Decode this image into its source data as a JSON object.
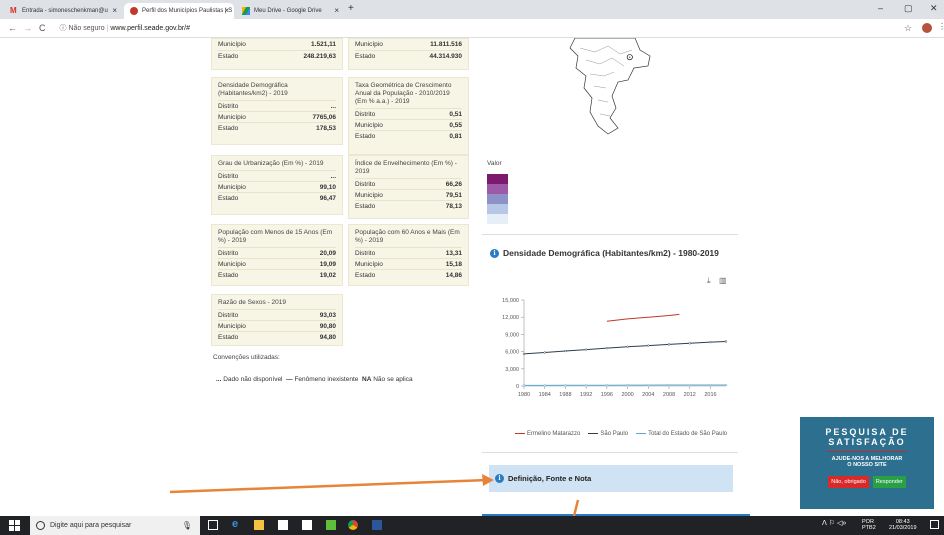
{
  "browser": {
    "tabs": [
      {
        "label": "Entrada - simoneschenkman@u"
      },
      {
        "label": "Perfil dos Municípios Paulistas | S"
      },
      {
        "label": "Meu Drive - Google Drive"
      }
    ],
    "new_tab": "+",
    "security": "Não seguro",
    "url": "www.perfil.seade.gov.br/#",
    "window_controls": {
      "minimize": "–",
      "maximize": "▢",
      "close": "✕"
    }
  },
  "cards": [
    {
      "title": "",
      "rows": [
        {
          "label": "Município",
          "value": "1.521,11"
        },
        {
          "label": "Estado",
          "value": "248.219,63"
        }
      ]
    },
    {
      "title": "",
      "rows": [
        {
          "label": "Município",
          "value": "11.811.516"
        },
        {
          "label": "Estado",
          "value": "44.314.930"
        }
      ]
    },
    {
      "title": "Densidade Demográfica (Habitantes/km2) - 2019",
      "rows": [
        {
          "label": "Distrito",
          "value": "..."
        },
        {
          "label": "Município",
          "value": "7765,06"
        },
        {
          "label": "Estado",
          "value": "178,53"
        }
      ]
    },
    {
      "title": "Taxa Geométrica de Crescimento Anual da População - 2010/2019 (Em % a.a.) - 2019",
      "rows": [
        {
          "label": "Distrito",
          "value": "0,51"
        },
        {
          "label": "Município",
          "value": "0,55"
        },
        {
          "label": "Estado",
          "value": "0,81"
        }
      ]
    },
    {
      "title": "Grau de Urbanização (Em %) - 2019",
      "rows": [
        {
          "label": "Distrito",
          "value": "..."
        },
        {
          "label": "Município",
          "value": "99,10"
        },
        {
          "label": "Estado",
          "value": "96,47"
        }
      ]
    },
    {
      "title": "Índice de Envelhecimento (Em %) - 2019",
      "rows": [
        {
          "label": "Distrito",
          "value": "66,26"
        },
        {
          "label": "Município",
          "value": "79,51"
        },
        {
          "label": "Estado",
          "value": "78,13"
        }
      ]
    },
    {
      "title": "População com Menos de 15 Anos (Em %) - 2019",
      "rows": [
        {
          "label": "Distrito",
          "value": "20,09"
        },
        {
          "label": "Município",
          "value": "19,09"
        },
        {
          "label": "Estado",
          "value": "19,02"
        }
      ]
    },
    {
      "title": "População com 60 Anos e Mais (Em %) - 2019",
      "rows": [
        {
          "label": "Distrito",
          "value": "13,31"
        },
        {
          "label": "Município",
          "value": "15,18"
        },
        {
          "label": "Estado",
          "value": "14,86"
        }
      ]
    },
    {
      "title": "Razão de Sexos - 2019",
      "rows": [
        {
          "label": "Distrito",
          "value": "93,03"
        },
        {
          "label": "Município",
          "value": "90,80"
        },
        {
          "label": "Estado",
          "value": "94,80"
        }
      ]
    }
  ],
  "conventions": {
    "title": "Convenções utilizadas:",
    "items": [
      {
        "symbol": "...",
        "text": "Dado não disponível"
      },
      {
        "symbol": "—",
        "text": "Fenômeno inexistente"
      },
      {
        "symbol": "NA",
        "text": "Não se aplica"
      }
    ]
  },
  "map_legend": {
    "title": "Valor",
    "colors": [
      "#7b1a6e",
      "#9c5aa8",
      "#8e90c8",
      "#b7c7e6",
      "#e6eef7"
    ]
  },
  "chart_section_title": "Densidade Demográfica (Habitantes/km2) - 1980-2019",
  "chart_data": {
    "type": "line",
    "title": "Densidade Demográfica (Habitantes/km2) - 1980-2019",
    "x_ticks": [
      "1980",
      "1984",
      "1988",
      "1992",
      "1996",
      "2000",
      "2004",
      "2008",
      "2012",
      "2016"
    ],
    "y_ticks": [
      "0",
      "3,000",
      "6,000",
      "9,000",
      "12,000",
      "15,000"
    ],
    "ylim": [
      0,
      15000
    ],
    "xlim": [
      1980,
      2019
    ],
    "series": [
      {
        "name": "Ermelino Matarazzo",
        "color": "#c0392b",
        "x": [
          1996,
          2000,
          2004,
          2008,
          2010
        ],
        "y": [
          11300,
          11700,
          12000,
          12300,
          12500
        ]
      },
      {
        "name": "São Paulo",
        "color": "#2c3e50",
        "x": [
          1980,
          1984,
          1988,
          1992,
          1996,
          2000,
          2004,
          2008,
          2012,
          2016,
          2019
        ],
        "y": [
          5600,
          5850,
          6100,
          6350,
          6600,
          6850,
          7050,
          7250,
          7450,
          7650,
          7765
        ]
      },
      {
        "name": "Total do Estado de São Paulo",
        "color": "#5aa9c9",
        "x": [
          1980,
          1984,
          1988,
          1992,
          1996,
          2000,
          2004,
          2008,
          2012,
          2016,
          2019
        ],
        "y": [
          100,
          110,
          120,
          130,
          140,
          150,
          160,
          165,
          170,
          175,
          179
        ]
      }
    ],
    "legend_position": "bottom"
  },
  "definition_box": "Definição, Fonte e Nota",
  "survey": {
    "line1": "PESQUISA DE",
    "line2": "SATISFAÇÃO",
    "line3": "AJUDE-NOS A MELHORAR",
    "line4": "O NOSSO SITE",
    "no_button": "Não, obrigado",
    "yes_button": "Responder"
  },
  "taskbar": {
    "search_placeholder": "Digite aqui para pesquisar",
    "lang": "POR",
    "lang2": "PTB2",
    "time": "08:43",
    "date": "21/03/2019"
  }
}
